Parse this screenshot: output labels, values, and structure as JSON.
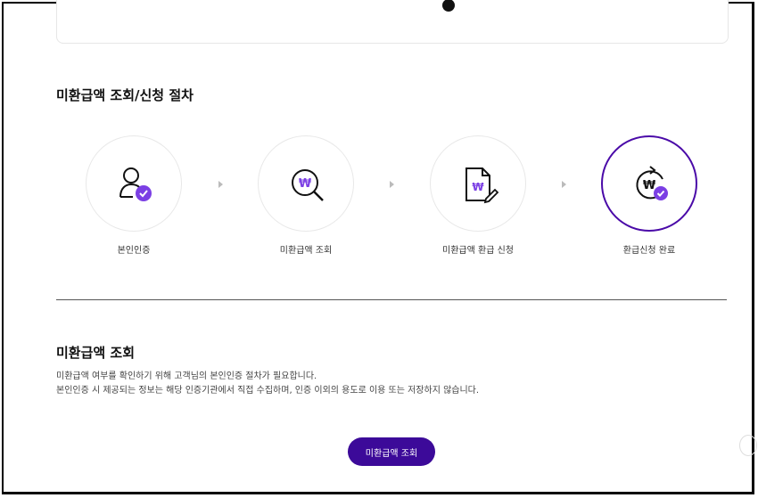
{
  "top_card": {
    "text": ""
  },
  "process": {
    "title": "미환급액 조회/신청 절차",
    "steps": [
      {
        "label": "본인인증",
        "icon": "user-check-icon"
      },
      {
        "label": "미환급액 조회",
        "icon": "won-search-icon"
      },
      {
        "label": "미환급액 환급 신청",
        "icon": "won-document-edit-icon"
      },
      {
        "label": "환급신청 완료",
        "icon": "won-refresh-check-icon",
        "active": true
      }
    ]
  },
  "inquiry": {
    "title": "미환급액 조회",
    "line1": "미환급액 여부를 확인하기 위해 고객님의 본인인증 절차가 필요합니다.",
    "line2": "본인인증 시 제공되는 정보는 해당 인증기관에서 직접 수집하며, 인증 이외의 용도로 이용 또는 저장하지 않습니다.",
    "button_label": "미환급액 조회"
  },
  "colors": {
    "accent": "#3c0a99",
    "badge": "#7b3fe4",
    "active_ring": "#4a0aa8"
  }
}
